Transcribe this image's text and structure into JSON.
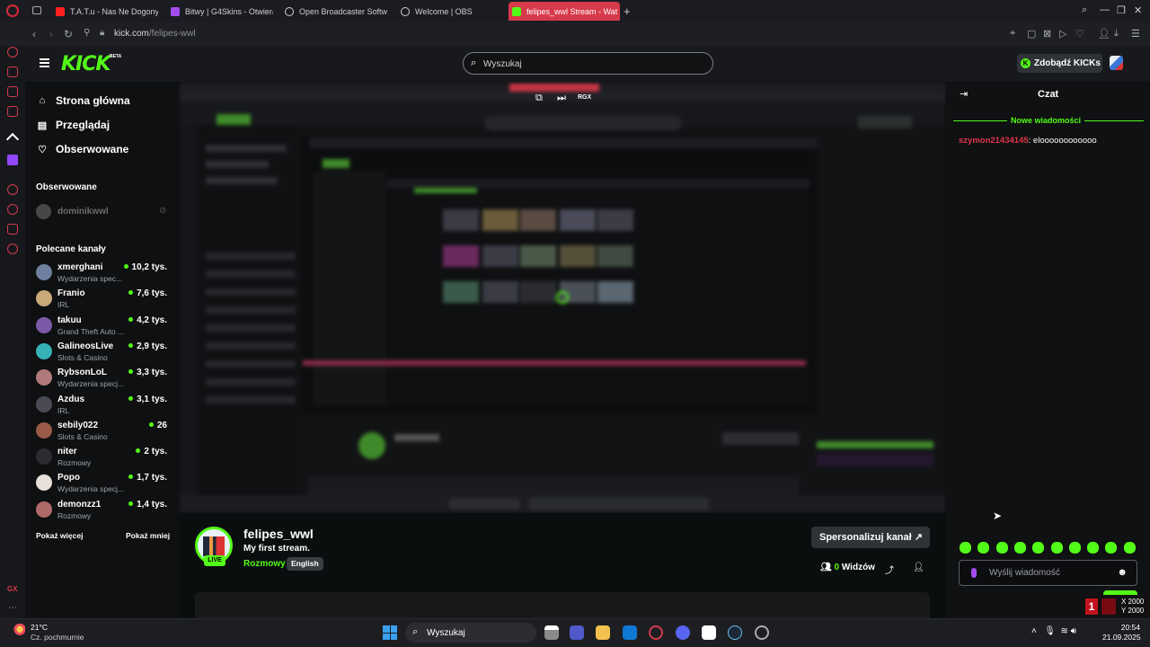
{
  "browser": {
    "tabs": [
      {
        "label": "T.A.T.u - Nas Ne Dogony",
        "color": "#ff2020"
      },
      {
        "label": "Bitwy | G4Skins - Otwiera",
        "color": "#a44cf0"
      },
      {
        "label": "Open Broadcaster Softwa",
        "color": "#cfcfd3"
      },
      {
        "label": "Welcome | OBS",
        "color": "#cfcfd3"
      },
      {
        "label": "felipes_wwl Stream - Wat",
        "color": "#53fc18",
        "active": true
      }
    ],
    "new_tab": "+",
    "url_domain": "kick.com",
    "url_path": "/felipes-wwl"
  },
  "header": {
    "logo": "KICK",
    "beta": "BETA",
    "search_placeholder": "Wyszukaj",
    "get_kicks": "Zdobądź KICKs"
  },
  "nav": {
    "home": "Strona główna",
    "browse": "Przeglądaj",
    "following": "Obserwowane"
  },
  "followed_section": "Obserwowane",
  "followed_channels": [
    {
      "name": "dominikwwl"
    }
  ],
  "recommended_section": "Polecane kanały",
  "recommended": [
    {
      "name": "xmerghani",
      "category": "Wydarzenia spec...",
      "viewers": "10,2 tys.",
      "color": "#6f7fa0"
    },
    {
      "name": "Franio",
      "category": "IRL",
      "viewers": "7,6 tys.",
      "color": "#c9a87a"
    },
    {
      "name": "takuu",
      "category": "Grand Theft Auto ...",
      "viewers": "4,2 tys.",
      "color": "#7a5aa8"
    },
    {
      "name": "GalineosLive",
      "category": "Slots & Casino",
      "viewers": "2,9 tys.",
      "color": "#38b0b8"
    },
    {
      "name": "RybsonLoL",
      "category": "Wydarzenia specj...",
      "viewers": "3,3 tys.",
      "color": "#b07a7a"
    },
    {
      "name": "Azdus",
      "category": "IRL",
      "viewers": "3,1 tys.",
      "color": "#4a4a52"
    },
    {
      "name": "sebily022",
      "category": "Slots & Casino",
      "viewers": "26",
      "color": "#9a5a48"
    },
    {
      "name": "niter",
      "category": "Rozmowy",
      "viewers": "2 tys.",
      "color": "#2c2c30"
    },
    {
      "name": "Popo",
      "category": "Wydarzenia specj...",
      "viewers": "1,7 tys.",
      "color": "#e8e0d8"
    },
    {
      "name": "demonzz1",
      "category": "Rozmowy",
      "viewers": "1,4 tys.",
      "color": "#b06a6a"
    }
  ],
  "show_more": "Pokaż więcej",
  "show_less": "Pokaż mniej",
  "player": {
    "quality": "RGX"
  },
  "stream": {
    "streamer": "felipes_wwl",
    "title": "My first stream.",
    "category": "Rozmowy",
    "language": "English",
    "live": "LIVE",
    "viewers_count": "0",
    "viewers_label": "Widzów",
    "customize": "Spersonalizuj kanał"
  },
  "chat": {
    "title": "Czat",
    "new_messages": "Nowe wiadomości",
    "messages": [
      {
        "user": "szymon21434145",
        "text": ": eloooooooooooo"
      }
    ],
    "input_placeholder": "Wyślij wiadomość"
  },
  "overlay": {
    "x": "X 2000",
    "y": "Y 2000",
    "badge": "1"
  },
  "taskbar": {
    "temperature": "21°C",
    "weather": "Cz. pochmurnie",
    "search_placeholder": "Wyszukaj",
    "time": "20:54",
    "date": "21.09.2025"
  }
}
